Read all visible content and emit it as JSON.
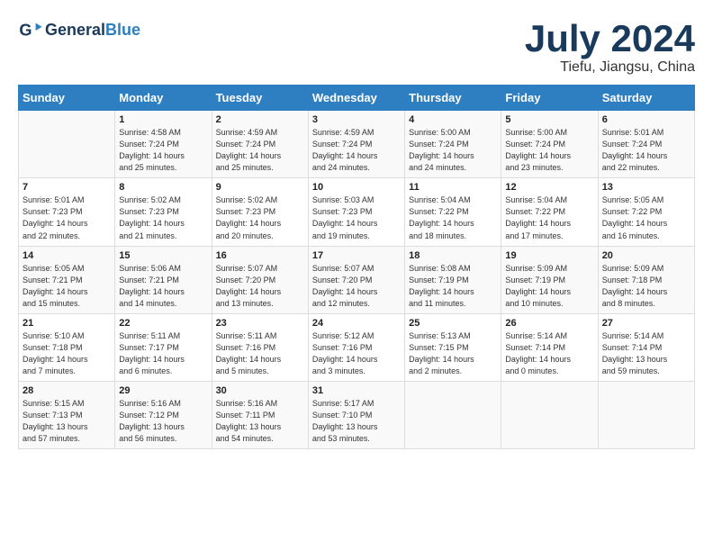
{
  "header": {
    "logo_general": "General",
    "logo_blue": "Blue",
    "month_year": "July 2024",
    "location": "Tiefu, Jiangsu, China"
  },
  "days_of_week": [
    "Sunday",
    "Monday",
    "Tuesday",
    "Wednesday",
    "Thursday",
    "Friday",
    "Saturday"
  ],
  "weeks": [
    [
      {
        "day": "",
        "info": ""
      },
      {
        "day": "1",
        "info": "Sunrise: 4:58 AM\nSunset: 7:24 PM\nDaylight: 14 hours\nand 25 minutes."
      },
      {
        "day": "2",
        "info": "Sunrise: 4:59 AM\nSunset: 7:24 PM\nDaylight: 14 hours\nand 25 minutes."
      },
      {
        "day": "3",
        "info": "Sunrise: 4:59 AM\nSunset: 7:24 PM\nDaylight: 14 hours\nand 24 minutes."
      },
      {
        "day": "4",
        "info": "Sunrise: 5:00 AM\nSunset: 7:24 PM\nDaylight: 14 hours\nand 24 minutes."
      },
      {
        "day": "5",
        "info": "Sunrise: 5:00 AM\nSunset: 7:24 PM\nDaylight: 14 hours\nand 23 minutes."
      },
      {
        "day": "6",
        "info": "Sunrise: 5:01 AM\nSunset: 7:24 PM\nDaylight: 14 hours\nand 22 minutes."
      }
    ],
    [
      {
        "day": "7",
        "info": "Sunrise: 5:01 AM\nSunset: 7:23 PM\nDaylight: 14 hours\nand 22 minutes."
      },
      {
        "day": "8",
        "info": "Sunrise: 5:02 AM\nSunset: 7:23 PM\nDaylight: 14 hours\nand 21 minutes."
      },
      {
        "day": "9",
        "info": "Sunrise: 5:02 AM\nSunset: 7:23 PM\nDaylight: 14 hours\nand 20 minutes."
      },
      {
        "day": "10",
        "info": "Sunrise: 5:03 AM\nSunset: 7:23 PM\nDaylight: 14 hours\nand 19 minutes."
      },
      {
        "day": "11",
        "info": "Sunrise: 5:04 AM\nSunset: 7:22 PM\nDaylight: 14 hours\nand 18 minutes."
      },
      {
        "day": "12",
        "info": "Sunrise: 5:04 AM\nSunset: 7:22 PM\nDaylight: 14 hours\nand 17 minutes."
      },
      {
        "day": "13",
        "info": "Sunrise: 5:05 AM\nSunset: 7:22 PM\nDaylight: 14 hours\nand 16 minutes."
      }
    ],
    [
      {
        "day": "14",
        "info": "Sunrise: 5:05 AM\nSunset: 7:21 PM\nDaylight: 14 hours\nand 15 minutes."
      },
      {
        "day": "15",
        "info": "Sunrise: 5:06 AM\nSunset: 7:21 PM\nDaylight: 14 hours\nand 14 minutes."
      },
      {
        "day": "16",
        "info": "Sunrise: 5:07 AM\nSunset: 7:20 PM\nDaylight: 14 hours\nand 13 minutes."
      },
      {
        "day": "17",
        "info": "Sunrise: 5:07 AM\nSunset: 7:20 PM\nDaylight: 14 hours\nand 12 minutes."
      },
      {
        "day": "18",
        "info": "Sunrise: 5:08 AM\nSunset: 7:19 PM\nDaylight: 14 hours\nand 11 minutes."
      },
      {
        "day": "19",
        "info": "Sunrise: 5:09 AM\nSunset: 7:19 PM\nDaylight: 14 hours\nand 10 minutes."
      },
      {
        "day": "20",
        "info": "Sunrise: 5:09 AM\nSunset: 7:18 PM\nDaylight: 14 hours\nand 8 minutes."
      }
    ],
    [
      {
        "day": "21",
        "info": "Sunrise: 5:10 AM\nSunset: 7:18 PM\nDaylight: 14 hours\nand 7 minutes."
      },
      {
        "day": "22",
        "info": "Sunrise: 5:11 AM\nSunset: 7:17 PM\nDaylight: 14 hours\nand 6 minutes."
      },
      {
        "day": "23",
        "info": "Sunrise: 5:11 AM\nSunset: 7:16 PM\nDaylight: 14 hours\nand 5 minutes."
      },
      {
        "day": "24",
        "info": "Sunrise: 5:12 AM\nSunset: 7:16 PM\nDaylight: 14 hours\nand 3 minutes."
      },
      {
        "day": "25",
        "info": "Sunrise: 5:13 AM\nSunset: 7:15 PM\nDaylight: 14 hours\nand 2 minutes."
      },
      {
        "day": "26",
        "info": "Sunrise: 5:14 AM\nSunset: 7:14 PM\nDaylight: 14 hours\nand 0 minutes."
      },
      {
        "day": "27",
        "info": "Sunrise: 5:14 AM\nSunset: 7:14 PM\nDaylight: 13 hours\nand 59 minutes."
      }
    ],
    [
      {
        "day": "28",
        "info": "Sunrise: 5:15 AM\nSunset: 7:13 PM\nDaylight: 13 hours\nand 57 minutes."
      },
      {
        "day": "29",
        "info": "Sunrise: 5:16 AM\nSunset: 7:12 PM\nDaylight: 13 hours\nand 56 minutes."
      },
      {
        "day": "30",
        "info": "Sunrise: 5:16 AM\nSunset: 7:11 PM\nDaylight: 13 hours\nand 54 minutes."
      },
      {
        "day": "31",
        "info": "Sunrise: 5:17 AM\nSunset: 7:10 PM\nDaylight: 13 hours\nand 53 minutes."
      },
      {
        "day": "",
        "info": ""
      },
      {
        "day": "",
        "info": ""
      },
      {
        "day": "",
        "info": ""
      }
    ]
  ]
}
